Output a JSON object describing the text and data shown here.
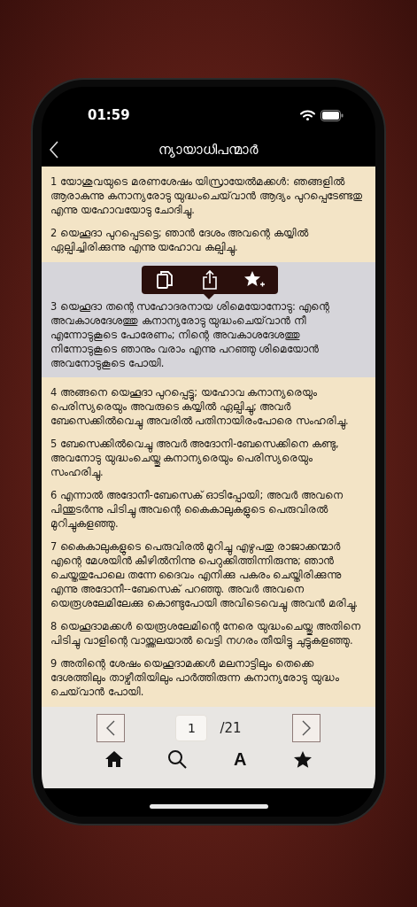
{
  "status_bar": {
    "time": "01:59"
  },
  "header": {
    "title": "ന്യായാധിപന്മാർ"
  },
  "verses": [
    {
      "text": "1 യോശുവയുടെ മരണശേഷം യിസ്രായേൽമക്കൾ: ഞങ്ങളിൽ ആരാകുന്നു കനാന്യരോടു യുദ്ധംചെയ്‌വാൻ ആദ്യം പുറപ്പെടേണ്ടതു എന്നു യഹോവയോടു ചോദിച്ചു.",
      "selected": false
    },
    {
      "text": "2 യെഹൂദാ പുറപ്പെടട്ടെ; ഞാൻ ദേശം അവന്റെ കയ്യിൽ ഏല്പിച്ചിരിക്കുന്നു എന്നു യഹോവ കല്പിച്ചു.",
      "selected": false
    },
    {
      "text": "3 യെഹൂദാ തന്റെ സഹോദരനായ ശിമെയോനോടു: എന്റെ അവകാശദേശത്തു കനാന്യരോടു യുദ്ധംചെയ്‌വാൻ നീ എന്നോടുകൂടെ പോരേണം; നിന്റെ അവകാശദേശത്തു നിന്നോടുകൂടെ ഞാനും വരാം എന്നു പറഞ്ഞു ശിമെയോൻ അവനോടുകൂടെ പോയി.",
      "selected": true
    },
    {
      "text": "4 അങ്ങനെ യെഹൂദാ പുറപ്പെട്ടു; യഹോവ കനാന്യരെയും പെരിസ്യരെയും അവരുടെ കയ്യിൽ ഏല്പിച്ചു; അവർ ബേസെക്കിൽവെച്ചു അവരിൽ പതിനായിരംപോരെ സംഹരിച്ചു.",
      "selected": false
    },
    {
      "text": "5 ബേസെക്കിൽവെച്ചു അവർ അദോനി-ബേസെക്കിനെ കണ്ടു, അവനോടു യുദ്ധംചെയ്തു കനാന്യരെയും പെരിസ്യരെയും സംഹരിച്ചു.",
      "selected": false
    },
    {
      "text": "6 എന്നാൽ അദോനീ-ബേസെക് ഓടിപ്പോയി; അവർ അവനെ പിന്തുടർന്നു പിടിച്ചു അവന്റെ കൈകാലുകളുടെ പെരുവിരൽ മുറിച്ചുകളഞ്ഞു.",
      "selected": false
    },
    {
      "text": "7 കൈകാലുകളുടെ പെരുവിരൽ മുറിച്ചു എഴുപതു രാജാക്കന്മാർ എന്റെ മേശയിൻ കീഴിൽനിന്നു പെറുക്കിത്തിന്നിരുന്നു; ഞാൻ ചെയ്തതുപോലെ തന്നേ ദൈവം എനിക്കു പകരം ചെയ്തിരിക്കുന്നു എന്നു അദോനീ--ബേസെക് പറഞ്ഞു. അവർ അവനെ യെരൂശലേമിലേക്കു കൊണ്ടുപോയി അവിടെവെച്ചു അവൻ മരിച്ചു.",
      "selected": false
    },
    {
      "text": "8 യെഹൂദാമക്കൾ യെരൂശലേമിന്റെ നേരെ യുദ്ധംചെയ്തു അതിനെ പിടിച്ചു വാളിന്റെ വായ്ത്തലയാൽ വെട്ടി നഗരം തീയിട്ടു ചുട്ടുകളഞ്ഞു.",
      "selected": false
    },
    {
      "text": "9 അതിന്റെ ശേഷം യെഹൂദാമക്കൾ മലനാട്ടിലും തെക്കെ ദേശത്തിലും താഴ്വീതിയിലും പാർത്തിരുന്ന കനാന്യരോടു യുദ്ധം ചെയ്‌വാൻ പോയി.",
      "selected": false
    }
  ],
  "popup": {
    "actions": [
      {
        "kind": "copy"
      },
      {
        "kind": "share"
      },
      {
        "kind": "favorite"
      }
    ]
  },
  "pager": {
    "page": "1",
    "total": "/21"
  },
  "toolbar": [
    {
      "kind": "home"
    },
    {
      "kind": "search"
    },
    {
      "kind": "font",
      "glyph": "A"
    },
    {
      "kind": "favorites"
    }
  ]
}
